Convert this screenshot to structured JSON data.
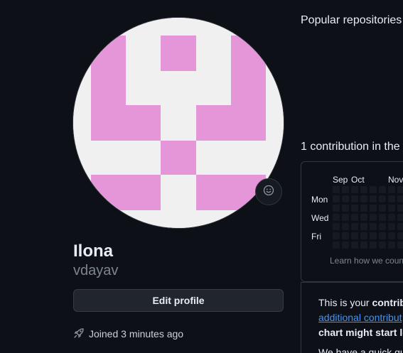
{
  "profile": {
    "display_name": "Ilona",
    "username": "vdayav",
    "edit_profile_label": "Edit profile",
    "joined_text": "Joined 3 minutes ago",
    "avatar_colors": {
      "background": "#f0f0f0",
      "foreground": "#e596d8"
    }
  },
  "popular": {
    "title": "Popular repositories"
  },
  "contributions": {
    "title": "1 contribution in the",
    "months": [
      "Sep",
      "Oct",
      "Nov"
    ],
    "days": [
      "Mon",
      "Wed",
      "Fri"
    ],
    "learn_text": "Learn how we count",
    "info_line1_normal": "This is your ",
    "info_line1_bold": "contrib",
    "info_line2_link": "additional contribut",
    "info_line3": "chart might start loo",
    "info_line4": "We have a quick gui"
  },
  "icons": {
    "status": "smiley-icon",
    "joined": "rocket-icon"
  },
  "colors": {
    "background": "#0d1117",
    "cell_empty": "#161b22",
    "link": "#4493f8",
    "muted": "#7d8590"
  }
}
